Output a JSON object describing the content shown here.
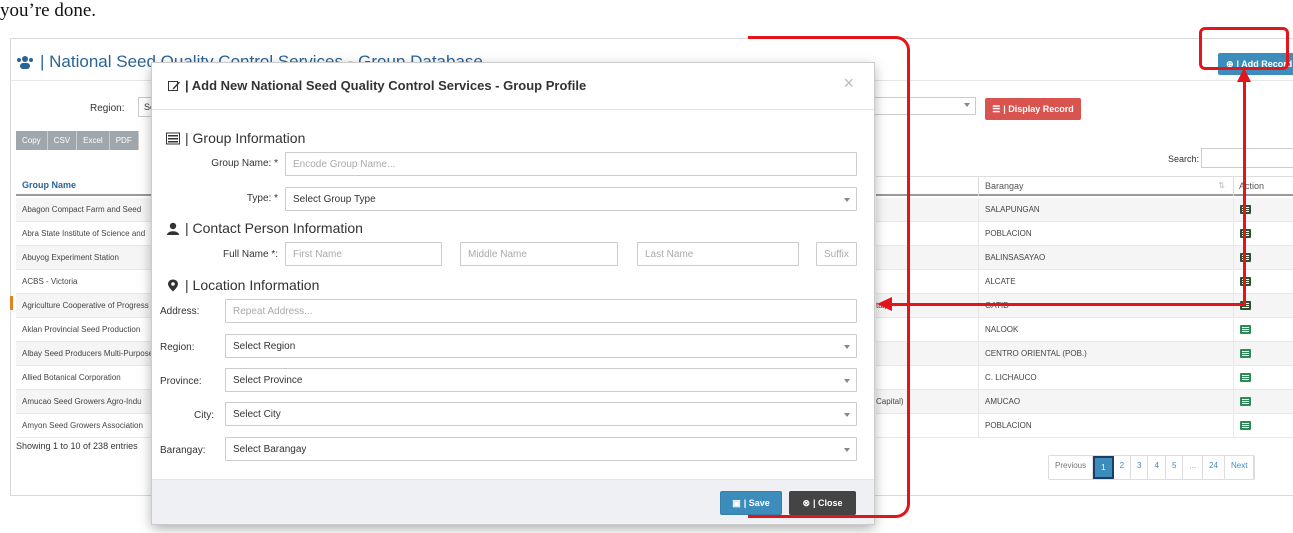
{
  "instruction_text": "you’re done.",
  "background": {
    "title": "| National Seed Quality Control Services - Group Database",
    "add_record_label": "| Add Record",
    "region_label": "Region:",
    "region_select_value": "Se",
    "display_record_label": "| Display Record",
    "export_buttons": [
      "Copy",
      "CSV",
      "Excel",
      "PDF"
    ],
    "search_label": "Search:",
    "table": {
      "col_group_name": "Group Name",
      "col_barangay": "Barangay",
      "col_action": "Action",
      "rows": [
        {
          "group_name": "Abagon Compact Farm and Seed",
          "middle": "",
          "barangay": "SALAPUNGAN"
        },
        {
          "group_name": "Abra State Institute of Science and",
          "middle": "",
          "barangay": "POBLACION"
        },
        {
          "group_name": "Abuyog Experiment Station",
          "middle": "",
          "barangay": "BALINSASAYAO"
        },
        {
          "group_name": "ACBS - Victoria",
          "middle": "",
          "barangay": "ALCATE"
        },
        {
          "group_name": "Agriculture Cooperative of Progress",
          "middle": "tal)",
          "barangay": "GATID"
        },
        {
          "group_name": "Aklan Provincial Seed Production",
          "middle": "",
          "barangay": "NALOOK"
        },
        {
          "group_name": "Albay Seed Producers Multi-Purpose",
          "middle": "",
          "barangay": "CENTRO ORIENTAL (POB.)"
        },
        {
          "group_name": "Allied Botanical Corporation",
          "middle": "",
          "barangay": "C. LICHAUCO"
        },
        {
          "group_name": "Amucao Seed Growers Agro-Indu",
          "middle": "Capital)",
          "barangay": "AMUCAO"
        },
        {
          "group_name": "Amyon Seed Growers Association",
          "middle": "",
          "barangay": "POBLACION"
        }
      ]
    },
    "showing_text": "Showing 1 to 10 of 238 entries",
    "pager": {
      "previous": "Previous",
      "pages": [
        "1",
        "2",
        "3",
        "4",
        "5"
      ],
      "ellipsis": "...",
      "last": "24",
      "next": "Next"
    }
  },
  "modal": {
    "title": "| Add New National Seed Quality Control Services - Group Profile",
    "close_x": "×",
    "group_info": {
      "title": "| Group Information",
      "group_name_label": "Group Name: *",
      "group_name_placeholder": "Encode Group Name...",
      "type_label": "Type: *",
      "type_value": "Select Group Type"
    },
    "contact_info": {
      "title": "| Contact Person Information",
      "full_name_label": "Full Name *:",
      "first_name_placeholder": "First Name",
      "middle_name_placeholder": "Middle Name",
      "last_name_placeholder": "Last Name",
      "suffix_placeholder": "Suffix"
    },
    "location_info": {
      "title": "| Location Information",
      "address_label": "Address:",
      "address_placeholder": "Repeat Address...",
      "region_label": "Region:",
      "region_value": "Select Region",
      "province_label": "Province:",
      "province_value": "Select Province",
      "city_label": "City:",
      "city_value": "Select City",
      "barangay_label": "Barangay:",
      "barangay_value": "Select Barangay"
    },
    "save_label": "| Save",
    "close_label": "| Close"
  },
  "colors": {
    "primary": "#3c8dbc",
    "danger": "#d9534f",
    "annotation_red": "#e3151a",
    "dark_button": "#444444"
  }
}
